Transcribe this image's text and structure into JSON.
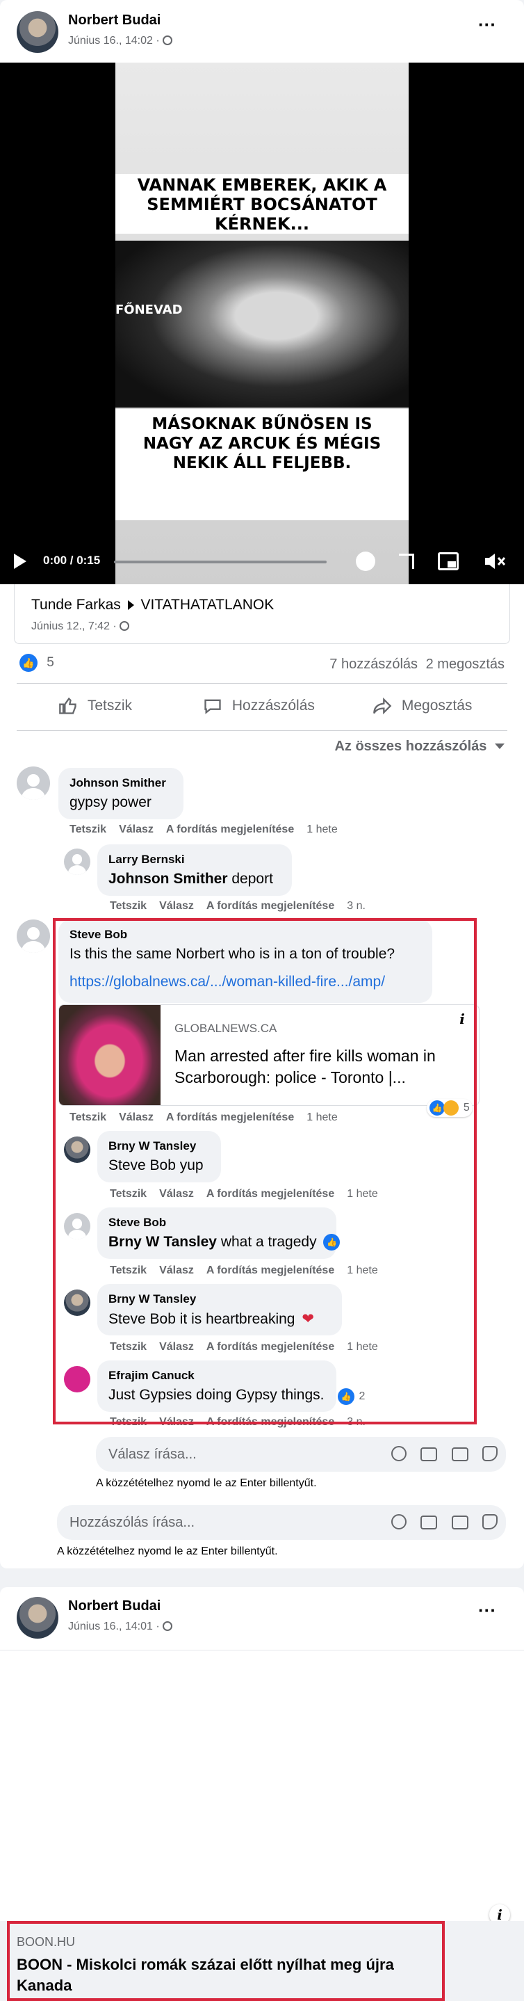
{
  "post1": {
    "author": "Norbert Budai",
    "date": "Június 16., 14:02 ·",
    "more": "···",
    "video": {
      "top_text": "VANNAK EMBEREK, AKIK A SEMMIÉRT BOCSÁNATOT KÉRNEK...",
      "bottom_text": "MÁSOKNAK BŰNÖSEN IS NAGY AZ ARCUK ÉS MÉGIS NEKIK ÁLL FELJEBB.",
      "watermark": "FŐNEVAD",
      "time": "0:00 / 0:15",
      "progress": 0
    },
    "shared_from": {
      "user": "Tunde Farkas",
      "group": "VITATHATATLANOK",
      "date": "Június 12., 7:42 ·"
    },
    "stats": {
      "likes": "5",
      "comments": "7 hozzászólás",
      "shares": "2 megosztás"
    },
    "buttons": {
      "like": "Tetszik",
      "comment": "Hozzászólás",
      "share": "Megosztás"
    },
    "filter": "Az összes hozzászólás"
  },
  "comments": [
    {
      "name": "Johnson Smither",
      "text": "gypsy power",
      "actions": [
        "Tetszik",
        "Válasz",
        "A fordítás megjelenítése"
      ],
      "time": "1 hete"
    },
    {
      "name": "Larry Bernski",
      "mention": "Johnson Smither",
      "text": " deport",
      "actions": [
        "Tetszik",
        "Válasz",
        "A fordítás megjelenítése"
      ],
      "time": "3 n."
    },
    {
      "name": "Steve Bob",
      "text": "Is this the same Norbert who is in a ton of trouble?",
      "link": "https://globalnews.ca/.../woman-killed-fire.../amp/",
      "preview": {
        "domain": "GLOBALNEWS.CA",
        "title_line1": "Man arrested after fire kills woman in",
        "title_line2": "Scarborough: police - Toronto |..."
      },
      "reactions": "5",
      "actions": [
        "Tetszik",
        "Válasz",
        "A fordítás megjelenítése"
      ],
      "time": "1 hete"
    },
    {
      "name": "Brny W Tansley",
      "text": "Steve Bob yup",
      "actions": [
        "Tetszik",
        "Válasz",
        "A fordítás megjelenítése"
      ],
      "time": "1 hete"
    },
    {
      "name": "Steve Bob",
      "mention": "Brny W Tansley",
      "text": " what a tragedy",
      "actions": [
        "Tetszik",
        "Válasz",
        "A fordítás megjelenítése"
      ],
      "time": "1 hete"
    },
    {
      "name": "Brny W Tansley",
      "text": "Steve Bob it is heartbreaking",
      "actions": [
        "Tetszik",
        "Válasz",
        "A fordítás megjelenítése"
      ],
      "time": "1 hete"
    },
    {
      "name": "Efrajim Canuck",
      "text": "Just Gypsies doing Gypsy things.",
      "reactions": "2",
      "actions": [
        "Tetszik",
        "Válasz",
        "A fordítás megjelenítése"
      ],
      "time": "3 n."
    }
  ],
  "reply_input": {
    "placeholder": "Válasz írása...",
    "hint": "A közzétételhez nyomd le az Enter billentyűt."
  },
  "comment_input": {
    "placeholder": "Hozzászólás írása...",
    "hint": "A közzétételhez nyomd le az Enter billentyűt."
  },
  "post2": {
    "author": "Norbert Budai",
    "date": "Június 16., 14:01 ·",
    "more": "···",
    "link": {
      "domain": "BOON.HU",
      "title_line1": "BOON - Miskolci romák százai előtt nyílhat meg újra",
      "title_line2": "Kanada"
    }
  },
  "colors": {
    "facebook_blue": "#1877f2",
    "highlight_red": "#d7263d",
    "link_blue": "#216fdb"
  }
}
